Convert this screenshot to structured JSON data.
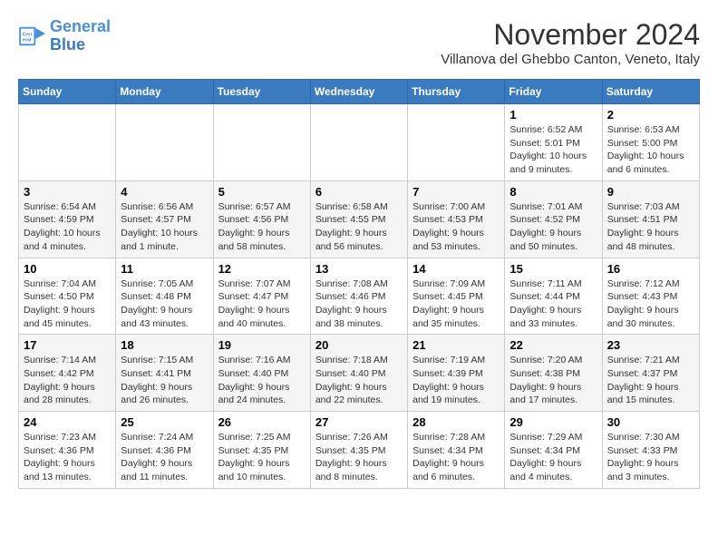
{
  "header": {
    "logo_line1": "General",
    "logo_line2": "Blue",
    "month_title": "November 2024",
    "location": "Villanova del Ghebbo Canton, Veneto, Italy"
  },
  "weekdays": [
    "Sunday",
    "Monday",
    "Tuesday",
    "Wednesday",
    "Thursday",
    "Friday",
    "Saturday"
  ],
  "weeks": [
    [
      {
        "day": "",
        "info": ""
      },
      {
        "day": "",
        "info": ""
      },
      {
        "day": "",
        "info": ""
      },
      {
        "day": "",
        "info": ""
      },
      {
        "day": "",
        "info": ""
      },
      {
        "day": "1",
        "info": "Sunrise: 6:52 AM\nSunset: 5:01 PM\nDaylight: 10 hours and 9 minutes."
      },
      {
        "day": "2",
        "info": "Sunrise: 6:53 AM\nSunset: 5:00 PM\nDaylight: 10 hours and 6 minutes."
      }
    ],
    [
      {
        "day": "3",
        "info": "Sunrise: 6:54 AM\nSunset: 4:59 PM\nDaylight: 10 hours and 4 minutes."
      },
      {
        "day": "4",
        "info": "Sunrise: 6:56 AM\nSunset: 4:57 PM\nDaylight: 10 hours and 1 minute."
      },
      {
        "day": "5",
        "info": "Sunrise: 6:57 AM\nSunset: 4:56 PM\nDaylight: 9 hours and 58 minutes."
      },
      {
        "day": "6",
        "info": "Sunrise: 6:58 AM\nSunset: 4:55 PM\nDaylight: 9 hours and 56 minutes."
      },
      {
        "day": "7",
        "info": "Sunrise: 7:00 AM\nSunset: 4:53 PM\nDaylight: 9 hours and 53 minutes."
      },
      {
        "day": "8",
        "info": "Sunrise: 7:01 AM\nSunset: 4:52 PM\nDaylight: 9 hours and 50 minutes."
      },
      {
        "day": "9",
        "info": "Sunrise: 7:03 AM\nSunset: 4:51 PM\nDaylight: 9 hours and 48 minutes."
      }
    ],
    [
      {
        "day": "10",
        "info": "Sunrise: 7:04 AM\nSunset: 4:50 PM\nDaylight: 9 hours and 45 minutes."
      },
      {
        "day": "11",
        "info": "Sunrise: 7:05 AM\nSunset: 4:48 PM\nDaylight: 9 hours and 43 minutes."
      },
      {
        "day": "12",
        "info": "Sunrise: 7:07 AM\nSunset: 4:47 PM\nDaylight: 9 hours and 40 minutes."
      },
      {
        "day": "13",
        "info": "Sunrise: 7:08 AM\nSunset: 4:46 PM\nDaylight: 9 hours and 38 minutes."
      },
      {
        "day": "14",
        "info": "Sunrise: 7:09 AM\nSunset: 4:45 PM\nDaylight: 9 hours and 35 minutes."
      },
      {
        "day": "15",
        "info": "Sunrise: 7:11 AM\nSunset: 4:44 PM\nDaylight: 9 hours and 33 minutes."
      },
      {
        "day": "16",
        "info": "Sunrise: 7:12 AM\nSunset: 4:43 PM\nDaylight: 9 hours and 30 minutes."
      }
    ],
    [
      {
        "day": "17",
        "info": "Sunrise: 7:14 AM\nSunset: 4:42 PM\nDaylight: 9 hours and 28 minutes."
      },
      {
        "day": "18",
        "info": "Sunrise: 7:15 AM\nSunset: 4:41 PM\nDaylight: 9 hours and 26 minutes."
      },
      {
        "day": "19",
        "info": "Sunrise: 7:16 AM\nSunset: 4:40 PM\nDaylight: 9 hours and 24 minutes."
      },
      {
        "day": "20",
        "info": "Sunrise: 7:18 AM\nSunset: 4:40 PM\nDaylight: 9 hours and 22 minutes."
      },
      {
        "day": "21",
        "info": "Sunrise: 7:19 AM\nSunset: 4:39 PM\nDaylight: 9 hours and 19 minutes."
      },
      {
        "day": "22",
        "info": "Sunrise: 7:20 AM\nSunset: 4:38 PM\nDaylight: 9 hours and 17 minutes."
      },
      {
        "day": "23",
        "info": "Sunrise: 7:21 AM\nSunset: 4:37 PM\nDaylight: 9 hours and 15 minutes."
      }
    ],
    [
      {
        "day": "24",
        "info": "Sunrise: 7:23 AM\nSunset: 4:36 PM\nDaylight: 9 hours and 13 minutes."
      },
      {
        "day": "25",
        "info": "Sunrise: 7:24 AM\nSunset: 4:36 PM\nDaylight: 9 hours and 11 minutes."
      },
      {
        "day": "26",
        "info": "Sunrise: 7:25 AM\nSunset: 4:35 PM\nDaylight: 9 hours and 10 minutes."
      },
      {
        "day": "27",
        "info": "Sunrise: 7:26 AM\nSunset: 4:35 PM\nDaylight: 9 hours and 8 minutes."
      },
      {
        "day": "28",
        "info": "Sunrise: 7:28 AM\nSunset: 4:34 PM\nDaylight: 9 hours and 6 minutes."
      },
      {
        "day": "29",
        "info": "Sunrise: 7:29 AM\nSunset: 4:34 PM\nDaylight: 9 hours and 4 minutes."
      },
      {
        "day": "30",
        "info": "Sunrise: 7:30 AM\nSunset: 4:33 PM\nDaylight: 9 hours and 3 minutes."
      }
    ]
  ]
}
